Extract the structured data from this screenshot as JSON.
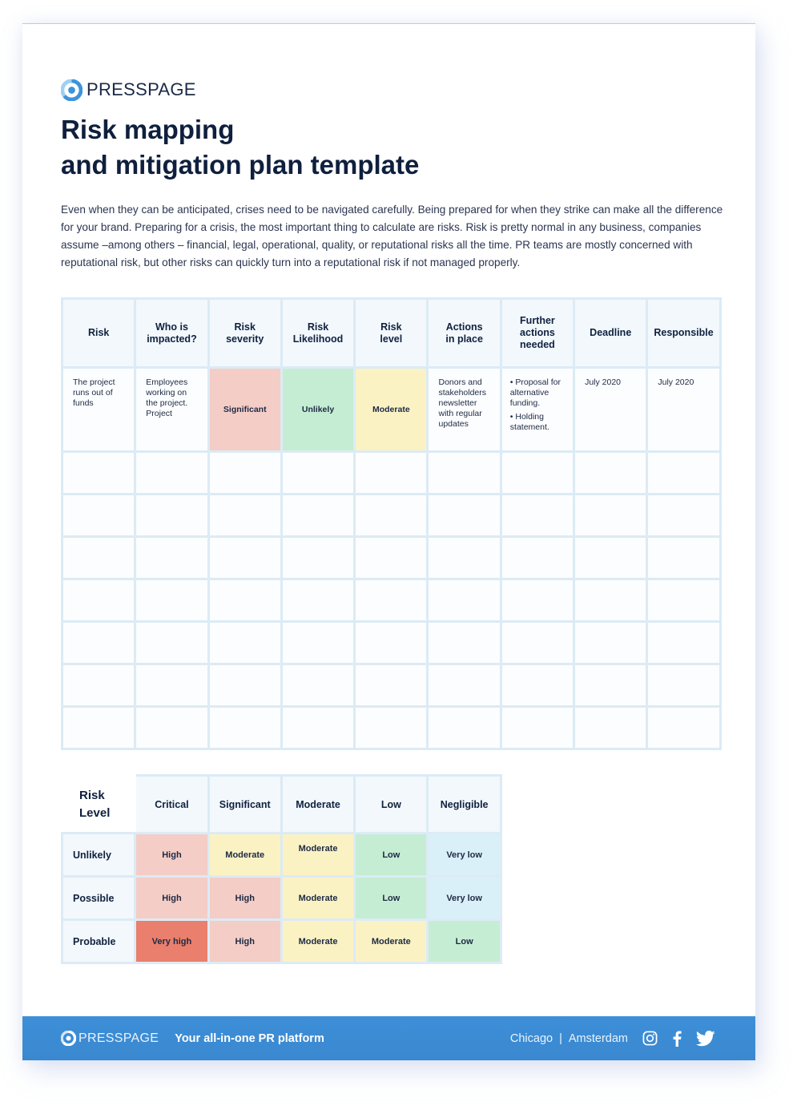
{
  "brand": {
    "name": "PRESSPAGE",
    "logo_icon": "presspage-logo-icon",
    "accent_color": "#3a8ad3"
  },
  "title": {
    "line1": "Risk mapping",
    "line2": "and mitigation plan template"
  },
  "intro": "Even when they can be anticipated, crises need to be navigated carefully. Being prepared for when they strike can make all the difference for your brand. Preparing for a crisis, the most important thing to calculate are risks. Risk is pretty normal in any business, companies assume –among others – financial, legal, operational, quality, or reputational risks all the time. PR teams are mostly concerned with reputational risk, but other risks can quickly turn into a reputational risk if not managed properly.",
  "risk_table": {
    "headers": [
      "Risk",
      "Who is impacted?",
      "Risk severity",
      "Risk Likelihood",
      "Risk level",
      "Actions in place",
      "Further actions needed",
      "Deadline",
      "Responsible"
    ],
    "example_row": {
      "risk": "The project runs out of funds",
      "who_impacted": "Employees working on the project. Project",
      "severity": "Significant",
      "likelihood": "Unlikely",
      "level": "Moderate",
      "actions_in_place": "Donors and stakeholders newsletter with regular updates",
      "further_actions": [
        "• Proposal for alternative funding.",
        "• Holding statement."
      ],
      "deadline": "July 2020",
      "responsible": "July 2020"
    },
    "empty_rows": 7
  },
  "risk_matrix": {
    "corner_line1": "Risk",
    "corner_line2": "Level",
    "severity_columns": [
      "Critical",
      "Significant",
      "Moderate",
      "Low",
      "Negligible"
    ],
    "rows": [
      {
        "likelihood": "Unlikely",
        "cells": [
          "High",
          "Moderate",
          "Moderate",
          "Low",
          "Very low"
        ]
      },
      {
        "likelihood": "Possible",
        "cells": [
          "High",
          "High",
          "Moderate",
          "Low",
          "Very low"
        ]
      },
      {
        "likelihood": "Probable",
        "cells": [
          "Very high",
          "High",
          "Moderate",
          "Moderate",
          "Low"
        ]
      }
    ],
    "level_colors": {
      "Very high": "#e97f6c",
      "High": "#f4cdc6",
      "Moderate": "#fbf2c4",
      "Low": "#c5edd3",
      "Very low": "#daf0f9"
    }
  },
  "footer": {
    "brand": "PRESSPAGE",
    "tagline": "Your all-in-one PR platform",
    "city1": "Chicago",
    "separator": "|",
    "city2": "Amsterdam",
    "social_icons": [
      "instagram-icon",
      "facebook-icon",
      "twitter-icon"
    ]
  }
}
